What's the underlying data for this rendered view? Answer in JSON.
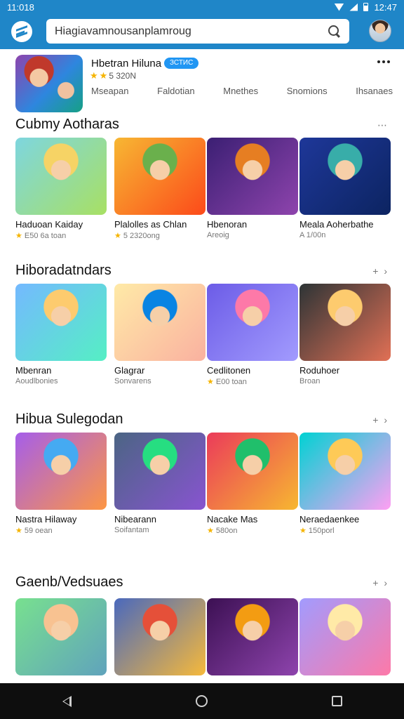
{
  "status_bar": {
    "time_left": "11:018",
    "time_right": "12:47"
  },
  "search": {
    "value": "Hiagiavamnousanplamroug"
  },
  "featured": {
    "title": "Hbetran Hiluna",
    "badge": "ЗСТИС",
    "rating_text": "5 320N",
    "tabs": [
      "Mseapan",
      "Faldotian",
      "Mnethes",
      "Snomions",
      "Ihsanaes"
    ]
  },
  "sections": [
    {
      "title": "Cubmy Aotharas",
      "action": "⋯",
      "cards": [
        {
          "title": "Haduoan Kaiday",
          "meta": "E50 6a toan",
          "star": true,
          "colors": [
            "#7ed6df",
            "#a8e063",
            "#f6d365"
          ]
        },
        {
          "title": "Plalolles as Chlan",
          "meta": "5 2320ong",
          "star": true,
          "colors": [
            "#f7b733",
            "#fc4a1a",
            "#6ab04c"
          ]
        },
        {
          "title": "Hbenoran",
          "meta": "Areoig",
          "star": false,
          "colors": [
            "#3b1f73",
            "#8e44ad",
            "#e67e22"
          ]
        },
        {
          "title": "Meala Aoherbathe",
          "meta": "A 1/00n",
          "star": false,
          "colors": [
            "#1e3799",
            "#0c2461",
            "#38ada9"
          ]
        }
      ]
    },
    {
      "title": "Hiboradatndars",
      "action": "+ ›",
      "cards": [
        {
          "title": "Mbenran",
          "meta": "Aoudlbonies",
          "star": false,
          "colors": [
            "#74b9ff",
            "#55efc4",
            "#fdcb6e"
          ]
        },
        {
          "title": "Glagrar",
          "meta": "Sonvarens",
          "star": false,
          "colors": [
            "#ffeaa7",
            "#fab1a0",
            "#0984e3"
          ]
        },
        {
          "title": "Cedlitonen",
          "meta": "E00 toan",
          "star": true,
          "colors": [
            "#6c5ce7",
            "#a29bfe",
            "#fd79a8"
          ]
        },
        {
          "title": "Roduhoer",
          "meta": "Broan",
          "star": false,
          "colors": [
            "#2d3436",
            "#e17055",
            "#fdcb6e"
          ]
        }
      ]
    },
    {
      "title": "Hibua Sulegodan",
      "action": "+ ›",
      "cards": [
        {
          "title": "Nastra Hilaway",
          "meta": "59 oean",
          "star": true,
          "colors": [
            "#a55eea",
            "#fd9644",
            "#45aaf2"
          ]
        },
        {
          "title": "Nibearann",
          "meta": "Soifantam",
          "star": false,
          "colors": [
            "#4b6584",
            "#8854d0",
            "#26de81"
          ]
        },
        {
          "title": "Nacake Mas",
          "meta": "580on",
          "star": true,
          "colors": [
            "#eb3b5a",
            "#f7b731",
            "#20bf6b"
          ]
        },
        {
          "title": "Neraedaenkee",
          "meta": "150porl",
          "star": true,
          "colors": [
            "#00d2d3",
            "#ff9ff3",
            "#feca57"
          ]
        }
      ]
    },
    {
      "title": "Gaenb/Vedsuaes",
      "action": "+ ›",
      "cards": [
        {
          "title": "",
          "meta": "",
          "star": false,
          "colors": [
            "#78e08f",
            "#60a3bc",
            "#f8c291"
          ]
        },
        {
          "title": "",
          "meta": "",
          "star": false,
          "colors": [
            "#4a69bd",
            "#f6b93b",
            "#e55039"
          ]
        },
        {
          "title": "",
          "meta": "",
          "star": false,
          "colors": [
            "#3c1053",
            "#8e44ad",
            "#f39c12"
          ]
        },
        {
          "title": "",
          "meta": "",
          "star": false,
          "colors": [
            "#a29bfe",
            "#fd79a8",
            "#ffeaa7"
          ]
        }
      ]
    }
  ]
}
